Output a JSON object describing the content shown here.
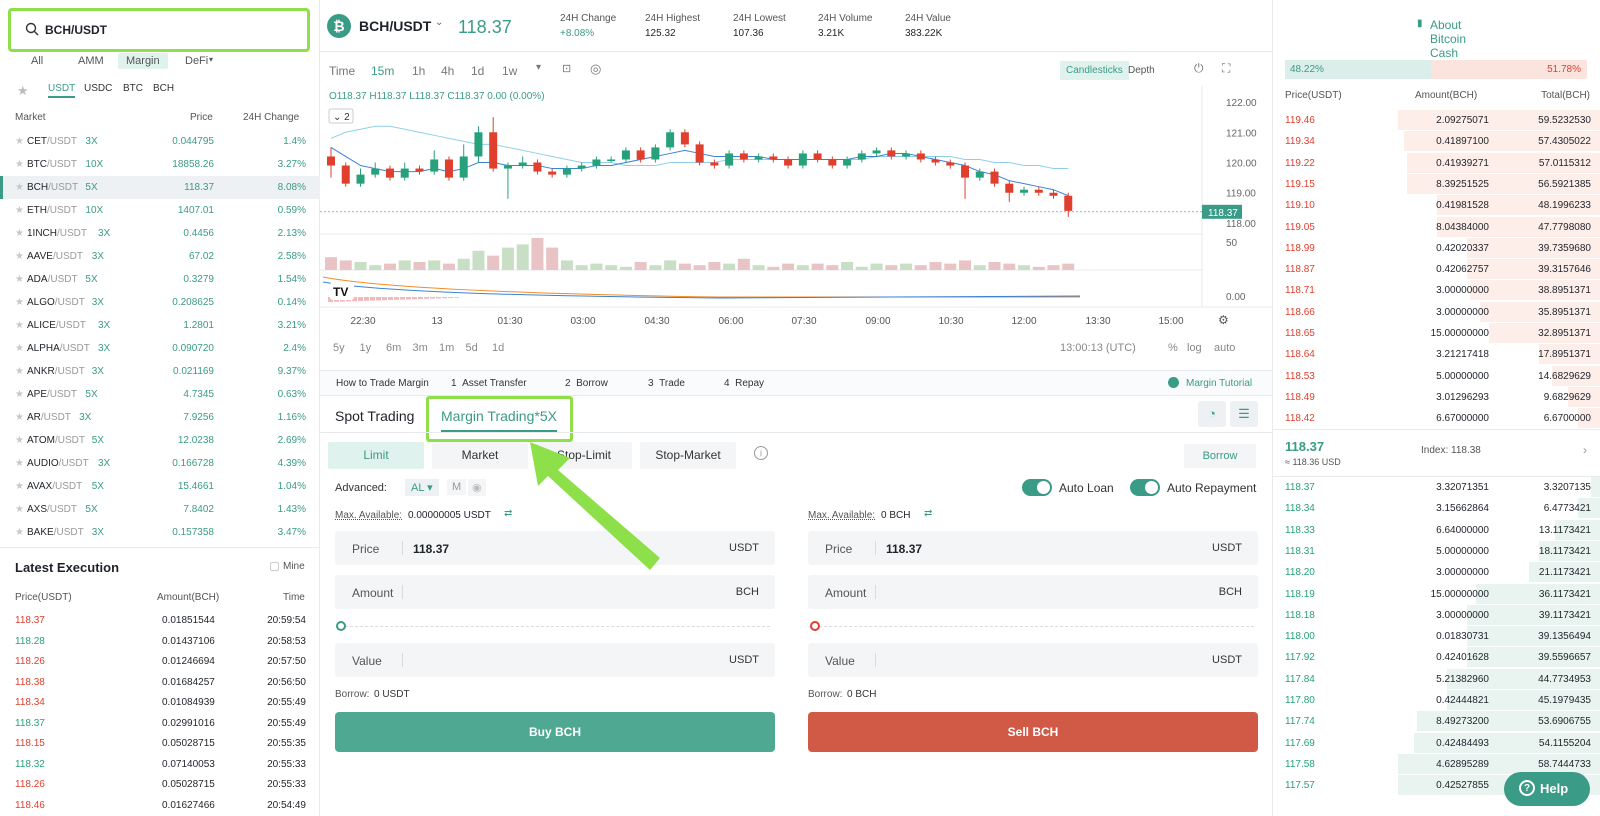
{
  "search": {
    "value": "BCH/USDT"
  },
  "market_tabs": [
    "All",
    "AMM",
    "Margin",
    "DeFi"
  ],
  "quote_tabs": [
    "USDT",
    "USDC",
    "BTC",
    "BCH"
  ],
  "market_table": {
    "headers": [
      "Market",
      "Price",
      "24H Change"
    ],
    "rows": [
      {
        "base": "CET",
        "quote": "/USDT",
        "lev": "3X",
        "price": "0.044795",
        "change": "1.4%"
      },
      {
        "base": "BTC",
        "quote": "/USDT",
        "lev": "10X",
        "price": "18858.26",
        "change": "3.27%"
      },
      {
        "base": "BCH",
        "quote": "/USDT",
        "lev": "5X",
        "price": "118.37",
        "change": "8.08%"
      },
      {
        "base": "ETH",
        "quote": "/USDT",
        "lev": "10X",
        "price": "1407.01",
        "change": "0.59%"
      },
      {
        "base": "1INCH",
        "quote": "/USDT",
        "lev": "3X",
        "price": "0.4456",
        "change": "2.13%"
      },
      {
        "base": "AAVE",
        "quote": "/USDT",
        "lev": "3X",
        "price": "67.02",
        "change": "2.58%"
      },
      {
        "base": "ADA",
        "quote": "/USDT",
        "lev": "5X",
        "price": "0.3279",
        "change": "1.54%"
      },
      {
        "base": "ALGO",
        "quote": "/USDT",
        "lev": "3X",
        "price": "0.208625",
        "change": "0.14%"
      },
      {
        "base": "ALICE",
        "quote": "/USDT",
        "lev": "3X",
        "price": "1.2801",
        "change": "3.21%"
      },
      {
        "base": "ALPHA",
        "quote": "/USDT",
        "lev": "3X",
        "price": "0.090720",
        "change": "2.4%"
      },
      {
        "base": "ANKR",
        "quote": "/USDT",
        "lev": "3X",
        "price": "0.021169",
        "change": "9.37%"
      },
      {
        "base": "APE",
        "quote": "/USDT",
        "lev": "5X",
        "price": "4.7345",
        "change": "0.63%"
      },
      {
        "base": "AR",
        "quote": "/USDT",
        "lev": "3X",
        "price": "7.9256",
        "change": "1.16%"
      },
      {
        "base": "ATOM",
        "quote": "/USDT",
        "lev": "5X",
        "price": "12.0238",
        "change": "2.69%"
      },
      {
        "base": "AUDIO",
        "quote": "/USDT",
        "lev": "3X",
        "price": "0.166728",
        "change": "4.39%"
      },
      {
        "base": "AVAX",
        "quote": "/USDT",
        "lev": "5X",
        "price": "15.4661",
        "change": "1.04%"
      },
      {
        "base": "AXS",
        "quote": "/USDT",
        "lev": "5X",
        "price": "7.8402",
        "change": "1.43%"
      },
      {
        "base": "BAKE",
        "quote": "/USDT",
        "lev": "3X",
        "price": "0.157358",
        "change": "3.47%"
      }
    ]
  },
  "latest_execution": {
    "title": "Latest Execution",
    "mine": "Mine",
    "headers": [
      "Price(USDT)",
      "Amount(BCH)",
      "Time"
    ],
    "rows": [
      {
        "price": "118.37",
        "amount": "0.01851544",
        "time": "20:59:54",
        "side": "dn"
      },
      {
        "price": "118.28",
        "amount": "0.01437106",
        "time": "20:58:53",
        "side": "up"
      },
      {
        "price": "118.26",
        "amount": "0.01246694",
        "time": "20:57:50",
        "side": "dn"
      },
      {
        "price": "118.38",
        "amount": "0.01684257",
        "time": "20:56:50",
        "side": "dn"
      },
      {
        "price": "118.34",
        "amount": "0.01084939",
        "time": "20:55:49",
        "side": "dn"
      },
      {
        "price": "118.37",
        "amount": "0.02991016",
        "time": "20:55:49",
        "side": "up"
      },
      {
        "price": "118.15",
        "amount": "0.05028715",
        "time": "20:55:35",
        "side": "dn"
      },
      {
        "price": "118.32",
        "amount": "0.07140053",
        "time": "20:55:33",
        "side": "up"
      },
      {
        "price": "118.26",
        "amount": "0.05028715",
        "time": "20:55:33",
        "side": "dn"
      },
      {
        "price": "118.46",
        "amount": "0.01627466",
        "time": "20:54:49",
        "side": "dn"
      }
    ]
  },
  "ticker": {
    "pair": "BCH/USDT",
    "price": "118.37",
    "stats": [
      {
        "label": "24H Change",
        "value": "+8.08%"
      },
      {
        "label": "24H Highest",
        "value": "125.32"
      },
      {
        "label": "24H Lowest",
        "value": "107.36"
      },
      {
        "label": "24H Volume",
        "value": "3.21K"
      },
      {
        "label": "24H Value",
        "value": "383.22K"
      }
    ],
    "about": "About Bitcoin Cash"
  },
  "chart_toolbar": {
    "intervals": [
      "Time",
      "15m",
      "1h",
      "4h",
      "1d",
      "1w"
    ],
    "views": [
      "Candlesticks",
      "Depth"
    ]
  },
  "chart_data": {
    "type": "candlestick",
    "ohlc_label": "O118.37 H118.37 L118.37 C118.37 0.00 (0.00%)",
    "indicator_count": "2",
    "y_ticks": [
      "122.00",
      "121.00",
      "120.00",
      "119.00",
      "118.00"
    ],
    "last_price": "118.37",
    "volume_ticks": [
      "50",
      "0.00"
    ],
    "x_ticks": [
      "22:30",
      "13",
      "01:30",
      "03:00",
      "04:30",
      "06:00",
      "07:30",
      "09:00",
      "10:30",
      "12:00",
      "13:30",
      "15:00"
    ],
    "candles": [
      [
        120.2,
        119.9,
        120.5,
        119.5
      ],
      [
        119.9,
        119.3,
        120.0,
        119.2
      ],
      [
        119.3,
        119.6,
        119.8,
        119.2
      ],
      [
        119.6,
        119.8,
        120.0,
        119.5
      ],
      [
        119.8,
        119.5,
        119.9,
        119.4
      ],
      [
        119.5,
        119.8,
        120.0,
        119.4
      ],
      [
        119.8,
        119.7,
        119.9,
        119.6
      ],
      [
        119.7,
        120.1,
        120.4,
        119.6
      ],
      [
        120.1,
        119.5,
        120.2,
        119.4
      ],
      [
        119.5,
        120.2,
        120.6,
        119.4
      ],
      [
        120.2,
        121.0,
        121.2,
        120.0
      ],
      [
        121.0,
        119.8,
        121.5,
        119.7
      ],
      [
        119.8,
        119.9,
        120.0,
        118.8
      ],
      [
        119.9,
        120.0,
        120.2,
        119.8
      ],
      [
        120.0,
        119.7,
        120.1,
        119.6
      ],
      [
        119.7,
        119.6,
        119.8,
        119.5
      ],
      [
        119.6,
        119.8,
        119.9,
        119.5
      ],
      [
        119.8,
        119.9,
        120.0,
        119.7
      ],
      [
        119.9,
        120.1,
        120.2,
        119.8
      ],
      [
        120.1,
        120.1,
        120.2,
        120.0
      ],
      [
        120.1,
        120.4,
        120.5,
        120.0
      ],
      [
        120.4,
        120.1,
        120.5,
        120.0
      ],
      [
        120.1,
        120.5,
        120.6,
        120.0
      ],
      [
        120.5,
        121.0,
        121.1,
        120.4
      ],
      [
        121.0,
        120.6,
        121.1,
        120.5
      ],
      [
        120.6,
        120.0,
        120.7,
        119.9
      ],
      [
        120.0,
        119.9,
        120.1,
        119.8
      ],
      [
        119.9,
        120.3,
        120.4,
        119.8
      ],
      [
        120.3,
        120.1,
        120.4,
        120.0
      ],
      [
        120.1,
        120.2,
        120.3,
        120.0
      ],
      [
        120.2,
        120.1,
        120.3,
        120.0
      ],
      [
        120.1,
        119.9,
        120.2,
        119.8
      ],
      [
        119.9,
        120.3,
        120.4,
        119.8
      ],
      [
        120.3,
        120.1,
        120.4,
        120.0
      ],
      [
        120.1,
        119.9,
        120.2,
        119.8
      ],
      [
        119.9,
        120.1,
        120.2,
        119.8
      ],
      [
        120.1,
        120.3,
        120.4,
        120.0
      ],
      [
        120.3,
        120.4,
        120.5,
        120.2
      ],
      [
        120.4,
        120.2,
        120.5,
        120.1
      ],
      [
        120.2,
        120.3,
        120.4,
        120.1
      ],
      [
        120.3,
        120.1,
        120.4,
        120.0
      ],
      [
        120.1,
        120.0,
        120.2,
        119.9
      ],
      [
        120.0,
        119.9,
        120.1,
        119.8
      ],
      [
        119.9,
        119.5,
        120.0,
        118.8
      ],
      [
        119.5,
        119.7,
        119.8,
        119.4
      ],
      [
        119.7,
        119.3,
        119.8,
        119.2
      ],
      [
        119.3,
        119.0,
        119.4,
        118.7
      ],
      [
        119.0,
        119.1,
        119.2,
        118.9
      ],
      [
        119.1,
        119.0,
        119.2,
        118.9
      ],
      [
        119.0,
        118.9,
        119.1,
        118.8
      ],
      [
        118.9,
        118.4,
        119.0,
        118.2
      ]
    ],
    "ma_fast": [
      120.5,
      120.2,
      119.9,
      119.8,
      119.7,
      119.7,
      119.7,
      119.8,
      119.7,
      119.8,
      120.0,
      120.0,
      119.9,
      119.9,
      119.9,
      119.8,
      119.8,
      119.8,
      119.9,
      119.9,
      120.0,
      120.1,
      120.2,
      120.3,
      120.4,
      120.3,
      120.2,
      120.2,
      120.2,
      120.2,
      120.1,
      120.1,
      120.1,
      120.1,
      120.1,
      120.1,
      120.2,
      120.2,
      120.3,
      120.3,
      120.2,
      120.1,
      120.0,
      119.9,
      119.7,
      119.6,
      119.4,
      119.3,
      119.2,
      119.1,
      118.9
    ],
    "ma_slow": [
      120.8,
      121.0,
      121.1,
      121.2,
      121.2,
      121.1,
      121.0,
      120.9,
      120.8,
      120.7,
      120.6,
      120.6,
      120.5,
      120.4,
      120.3,
      120.2,
      120.1,
      120.0,
      120.0,
      120.0,
      119.9,
      119.9,
      119.9,
      120.0,
      120.0,
      120.0,
      120.0,
      120.1,
      120.1,
      120.1,
      120.1,
      120.1,
      120.1,
      120.1,
      120.1,
      120.1,
      120.1,
      120.2,
      120.2,
      120.2,
      120.2,
      120.2,
      120.2,
      120.1,
      120.1,
      120.0,
      120.0,
      119.9,
      119.9,
      119.8,
      119.8
    ],
    "volumes": [
      8,
      6,
      5,
      3,
      4,
      6,
      5,
      6,
      4,
      7,
      12,
      9,
      14,
      16,
      20,
      14,
      6,
      3,
      4,
      3,
      2,
      5,
      3,
      6,
      4,
      3,
      5,
      4,
      7,
      3,
      2,
      4,
      3,
      4,
      3,
      5,
      2,
      4,
      3,
      4,
      3,
      5,
      4,
      6,
      3,
      5,
      4,
      3,
      2,
      3,
      4
    ],
    "range_buttons": [
      "5y",
      "1y",
      "6m",
      "3m",
      "1m",
      "5d",
      "1d"
    ],
    "clock": "13:00:13 (UTC)",
    "scale_buttons": [
      "%",
      "log",
      "auto"
    ]
  },
  "steps": {
    "title": "How to Trade Margin",
    "items": [
      {
        "n": "1",
        "label": "Asset Transfer"
      },
      {
        "n": "2",
        "label": "Borrow"
      },
      {
        "n": "3",
        "label": "Trade"
      },
      {
        "n": "4",
        "label": "Repay"
      }
    ],
    "tutorial": "Margin Tutorial"
  },
  "trade_tabs": {
    "spot": "Spot Trading",
    "margin": "Margin Trading*5X"
  },
  "order_types": [
    "Limit",
    "Market",
    "Stop-Limit",
    "Stop-Market"
  ],
  "borrow_btn": "Borrow",
  "advanced": {
    "label": "Advanced:",
    "al": "AL",
    "m": "M"
  },
  "toggles": {
    "auto_loan": "Auto Loan",
    "auto_repay": "Auto Repayment"
  },
  "buy": {
    "max_label": "Max. Available:",
    "max_value": "0.00000005 USDT",
    "price_label": "Price",
    "price": "118.37",
    "price_unit": "USDT",
    "amount_label": "Amount",
    "amount_unit": "BCH",
    "value_label": "Value",
    "value_unit": "USDT",
    "borrow_label": "Borrow:",
    "borrow_value": "0 USDT",
    "button": "Buy BCH"
  },
  "sell": {
    "max_label": "Max. Available:",
    "max_value": "0 BCH",
    "price_label": "Price",
    "price": "118.37",
    "price_unit": "USDT",
    "amount_label": "Amount",
    "amount_unit": "BCH",
    "value_label": "Value",
    "value_unit": "USDT",
    "borrow_label": "Borrow:",
    "borrow_value": "0 BCH",
    "button": "Sell BCH"
  },
  "orderbook": {
    "buy_pct": "48.22%",
    "sell_pct": "51.78%",
    "headers": [
      "Price(USDT)",
      "Amount(BCH)",
      "Total(BCH)"
    ],
    "asks": [
      {
        "p": "119.46",
        "a": "2.09275071",
        "t": "59.5232530",
        "d": 0.62
      },
      {
        "p": "119.34",
        "a": "0.41897100",
        "t": "57.4305022",
        "d": 0.6
      },
      {
        "p": "119.22",
        "a": "0.41939271",
        "t": "57.0115312",
        "d": 0.59
      },
      {
        "p": "119.15",
        "a": "8.39251525",
        "t": "56.5921385",
        "d": 0.59
      },
      {
        "p": "119.10",
        "a": "0.41981528",
        "t": "48.1996233",
        "d": 0.5
      },
      {
        "p": "119.05",
        "a": "8.04384000",
        "t": "47.7798080",
        "d": 0.5
      },
      {
        "p": "118.99",
        "a": "0.42020337",
        "t": "39.7359680",
        "d": 0.41
      },
      {
        "p": "118.87",
        "a": "0.42062757",
        "t": "39.3157646",
        "d": 0.41
      },
      {
        "p": "118.71",
        "a": "3.00000000",
        "t": "38.8951371",
        "d": 0.4
      },
      {
        "p": "118.66",
        "a": "3.00000000",
        "t": "35.8951371",
        "d": 0.37
      },
      {
        "p": "118.65",
        "a": "15.00000000",
        "t": "32.8951371",
        "d": 0.34
      },
      {
        "p": "118.64",
        "a": "3.21217418",
        "t": "17.8951371",
        "d": 0.19
      },
      {
        "p": "118.53",
        "a": "5.00000000",
        "t": "14.6829629",
        "d": 0.15
      },
      {
        "p": "118.49",
        "a": "3.01296293",
        "t": "9.6829629",
        "d": 0.1
      },
      {
        "p": "118.42",
        "a": "6.67000000",
        "t": "6.6700000",
        "d": 0.07
      }
    ],
    "mid_price": "118.37",
    "mid_usd": "≈ 118.36 USD",
    "index": "Index: 118.38",
    "bids": [
      {
        "p": "118.37",
        "a": "3.32071351",
        "t": "3.3207135",
        "d": 0.03
      },
      {
        "p": "118.34",
        "a": "3.15662864",
        "t": "6.4773421",
        "d": 0.07
      },
      {
        "p": "118.33",
        "a": "6.64000000",
        "t": "13.1173421",
        "d": 0.14
      },
      {
        "p": "118.31",
        "a": "5.00000000",
        "t": "18.1173421",
        "d": 0.19
      },
      {
        "p": "118.20",
        "a": "3.00000000",
        "t": "21.1173421",
        "d": 0.22
      },
      {
        "p": "118.19",
        "a": "15.00000000",
        "t": "36.1173421",
        "d": 0.38
      },
      {
        "p": "118.18",
        "a": "3.00000000",
        "t": "39.1173421",
        "d": 0.41
      },
      {
        "p": "118.00",
        "a": "0.01830731",
        "t": "39.1356494",
        "d": 0.41
      },
      {
        "p": "117.92",
        "a": "0.42401628",
        "t": "39.5596657",
        "d": 0.41
      },
      {
        "p": "117.84",
        "a": "5.21382960",
        "t": "44.7734953",
        "d": 0.47
      },
      {
        "p": "117.80",
        "a": "0.42444821",
        "t": "45.1979435",
        "d": 0.47
      },
      {
        "p": "117.74",
        "a": "8.49273200",
        "t": "53.6906755",
        "d": 0.56
      },
      {
        "p": "117.69",
        "a": "0.42484493",
        "t": "54.1155204",
        "d": 0.57
      },
      {
        "p": "117.58",
        "a": "4.62895289",
        "t": "58.7444733",
        "d": 0.62
      },
      {
        "p": "117.57",
        "a": "0.42527855",
        "t": "",
        "d": 0.62
      }
    ]
  },
  "help": "Help",
  "colors": {
    "accent": "#3a9b86",
    "buy": "#4ea892",
    "sell": "#d05a45",
    "up": "#26a17b",
    "down": "#e03f2e",
    "highlight": "#8ee04a"
  }
}
